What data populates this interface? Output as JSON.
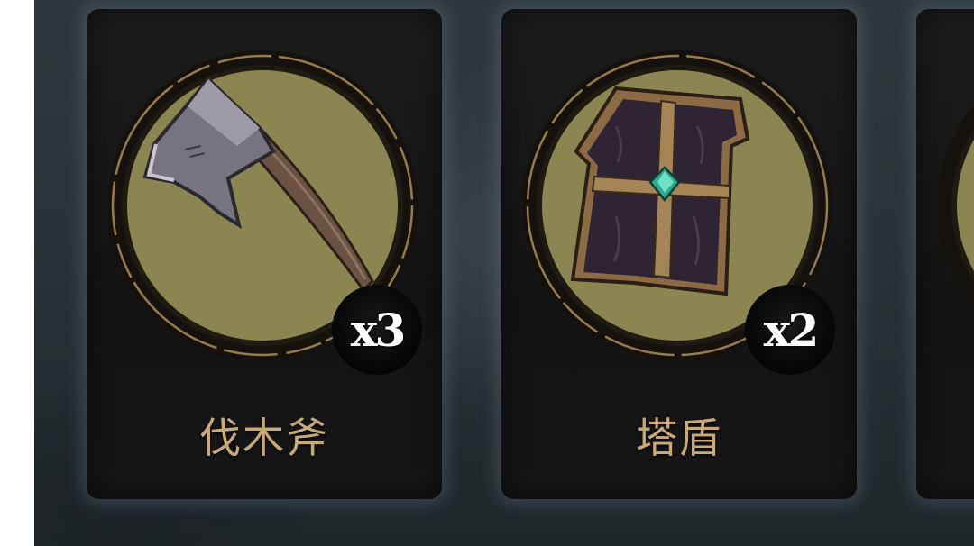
{
  "colors": {
    "medallion_fill": "#8a8551",
    "medallion_ring": "#1f1a12",
    "medallion_rim": "#b8965e",
    "label_text": "#c9a97a",
    "card_bg": "#181818"
  },
  "inventory": {
    "items": [
      {
        "name": "伐木斧",
        "count": "x3",
        "icon": "axe-icon"
      },
      {
        "name": "塔盾",
        "count": "x2",
        "icon": "shield-icon"
      },
      {
        "name": "",
        "count": "",
        "icon": ""
      }
    ]
  }
}
